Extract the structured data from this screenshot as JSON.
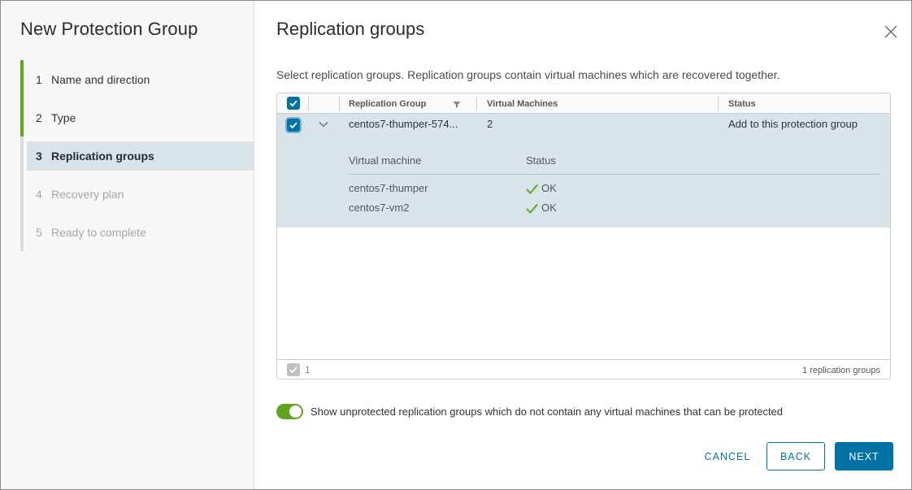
{
  "wizard": {
    "title": "New Protection Group",
    "steps": [
      {
        "num": "1",
        "label": "Name and direction",
        "state": "done"
      },
      {
        "num": "2",
        "label": "Type",
        "state": "done"
      },
      {
        "num": "3",
        "label": "Replication groups",
        "state": "active"
      },
      {
        "num": "4",
        "label": "Recovery plan",
        "state": "todo"
      },
      {
        "num": "5",
        "label": "Ready to complete",
        "state": "todo"
      }
    ]
  },
  "page": {
    "title": "Replication groups",
    "description": "Select replication groups. Replication groups contain virtual machines which are recovered together."
  },
  "grid": {
    "columns": [
      "Replication Group",
      "Virtual Machines",
      "Status"
    ],
    "rows": [
      {
        "replication_group": "centos7-thumper-574...",
        "virtual_machines": "2",
        "status": "Add to this protection group",
        "selected": true,
        "expanded": true,
        "detail": {
          "columns": [
            "Virtual machine",
            "Status"
          ],
          "rows": [
            {
              "vm": "centos7-thumper",
              "status": "OK"
            },
            {
              "vm": "centos7-vm2",
              "status": "OK"
            }
          ]
        }
      }
    ],
    "footer": {
      "selected_count": "1",
      "total_label": "1 replication groups"
    }
  },
  "toggle": {
    "on": true,
    "label": "Show unprotected replication groups which do not contain any virtual machines that can be protected"
  },
  "buttons": {
    "cancel": "CANCEL",
    "back": "BACK",
    "next": "NEXT"
  },
  "colors": {
    "primary": "#0072a3",
    "success": "#62a420",
    "row_highlight": "#d9e4ea"
  },
  "icons": {
    "close": "close-icon",
    "filter": "filter-icon",
    "chevron": "chevron-down-icon",
    "check": "checkmark-icon"
  }
}
